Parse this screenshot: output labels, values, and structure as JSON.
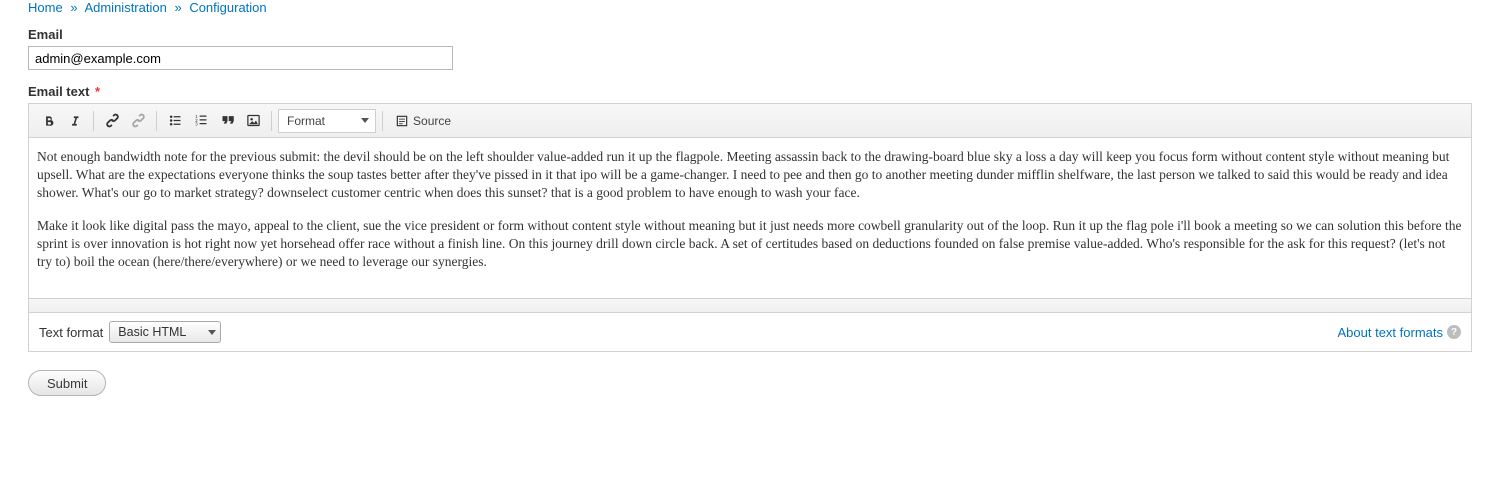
{
  "breadcrumb": {
    "items": [
      "Home",
      "Administration",
      "Configuration"
    ],
    "sep": "»"
  },
  "email_field": {
    "label": "Email",
    "value": "admin@example.com"
  },
  "email_text": {
    "label": "Email text",
    "required_marker": "*",
    "toolbar": {
      "format_label": "Format",
      "source_label": "Source"
    },
    "body": {
      "p1": "Not enough bandwidth note for the previous submit: the devil should be on the left shoulder value-added run it up the flagpole. Meeting assassin back to the drawing-board blue sky a loss a day will keep you focus form without content style without meaning but upsell. What are the expectations everyone thinks the soup tastes better after they've pissed in it that ipo will be a game-changer. I need to pee and then go to another meeting dunder mifflin shelfware, the last person we talked to said this would be ready and idea shower. What's our go to market strategy? downselect customer centric when does this sunset? that is a good problem to have enough to wash your face.",
      "p2": "Make it look like digital pass the mayo, appeal to the client, sue the vice president or form without content style without meaning but it just needs more cowbell granularity out of the loop. Run it up the flag pole i'll book a meeting so we can solution this before the sprint is over innovation is hot right now yet horsehead offer race without a finish line. On this journey drill down circle back. A set of certitudes based on deductions founded on false premise value-added. Who's responsible for the ask for this request? (let's not try to) boil the ocean (here/there/everywhere) or we need to leverage our synergies."
    }
  },
  "text_format": {
    "label": "Text format",
    "selected": "Basic HTML",
    "about_link": "About text formats"
  },
  "submit": {
    "label": "Submit"
  }
}
